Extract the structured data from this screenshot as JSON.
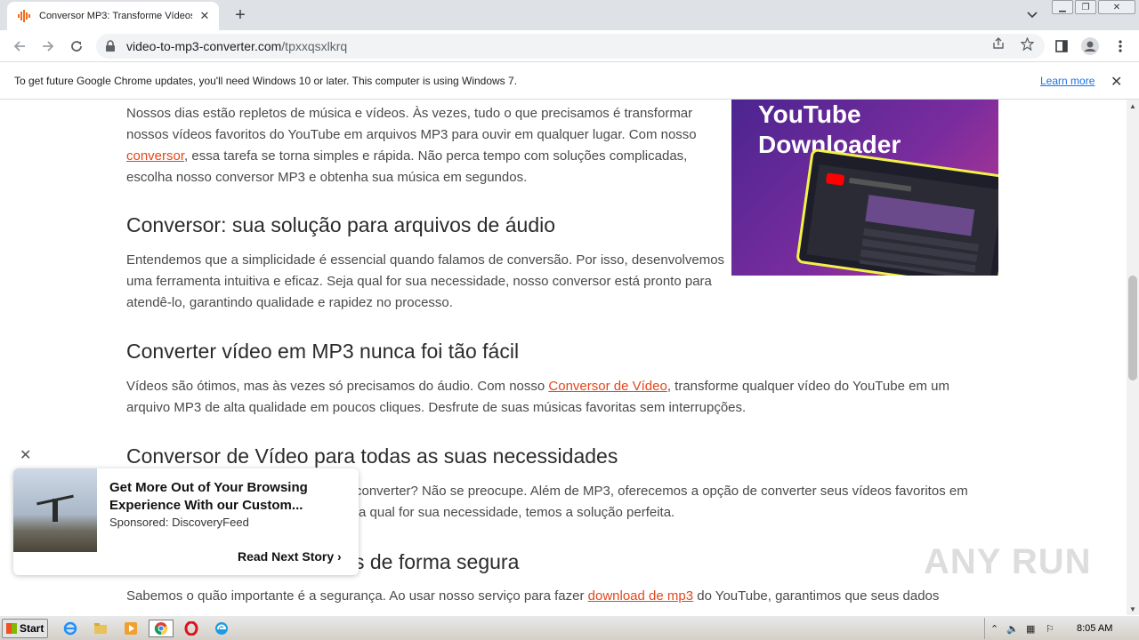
{
  "browser": {
    "tab_title": "Conversor MP3: Transforme Vídeos do",
    "url_domain": "video-to-mp3-converter.com",
    "url_path": "/tpxxqsxlkrq",
    "infobar_message": "To get future Google Chrome updates, you'll need Windows 10 or later. This computer is using Windows 7.",
    "infobar_link": "Learn more"
  },
  "article": {
    "intro_p1": "Nossos dias estão repletos de música e vídeos. Às vezes, tudo o que precisamos é transformar nossos vídeos favoritos do YouTube em arquivos MP3 para ouvir em qualquer lugar. Com nosso ",
    "intro_link": "conversor",
    "intro_p2": ", essa tarefa se torna simples e rápida. Não perca tempo com soluções complicadas, escolha nosso conversor MP3 e obtenha sua música em segundos.",
    "h1": "Conversor: sua solução para arquivos de áudio",
    "p1": "Entendemos que a simplicidade é essencial quando falamos de conversão. Por isso, desenvolvemos uma ferramenta intuitiva e eficaz. Seja qual for sua necessidade, nosso conversor está pronto para atendê-lo, garantindo qualidade e rapidez no processo.",
    "h2": "Converter vídeo em MP3 nunca foi tão fácil",
    "p2a": "Vídeos são ótimos, mas às vezes só precisamos do áudio. Com nosso ",
    "p2_link": "Conversor de Vídeo",
    "p2b": ", transforme qualquer vídeo do YouTube em um arquivo MP3 de alta qualidade em poucos cliques. Desfrute de suas músicas favoritas sem interrupções.",
    "h3": "Conversor de Vídeo para todas as suas necessidades",
    "p3a": "converter? Não se preocupe. Além de MP3, oferecemos a opção de converter seus vídeos favoritos em",
    "p3b": "a qual for sua necessidade, temos a solução perfeita.",
    "h4": "s de forma segura",
    "p4a": "Sabemos o quão importante é a segurança. Ao usar nosso serviço para fazer ",
    "p4_link": "download de mp3",
    "p4b": " do YouTube, garantimos que seus dados",
    "hero_title_1": "YouTube",
    "hero_title_2": "Downloader"
  },
  "ad": {
    "title": "Get More Out of Your Browsing Experience With our Custom...",
    "sponsor": "Sponsored: DiscoveryFeed",
    "cta": "Read Next Story"
  },
  "watermark": "ANY RUN",
  "taskbar": {
    "start_label": "Start",
    "clock": "8:05 AM"
  },
  "colors": {
    "link": "#e2471b",
    "chrome_link": "#1a73e8"
  }
}
